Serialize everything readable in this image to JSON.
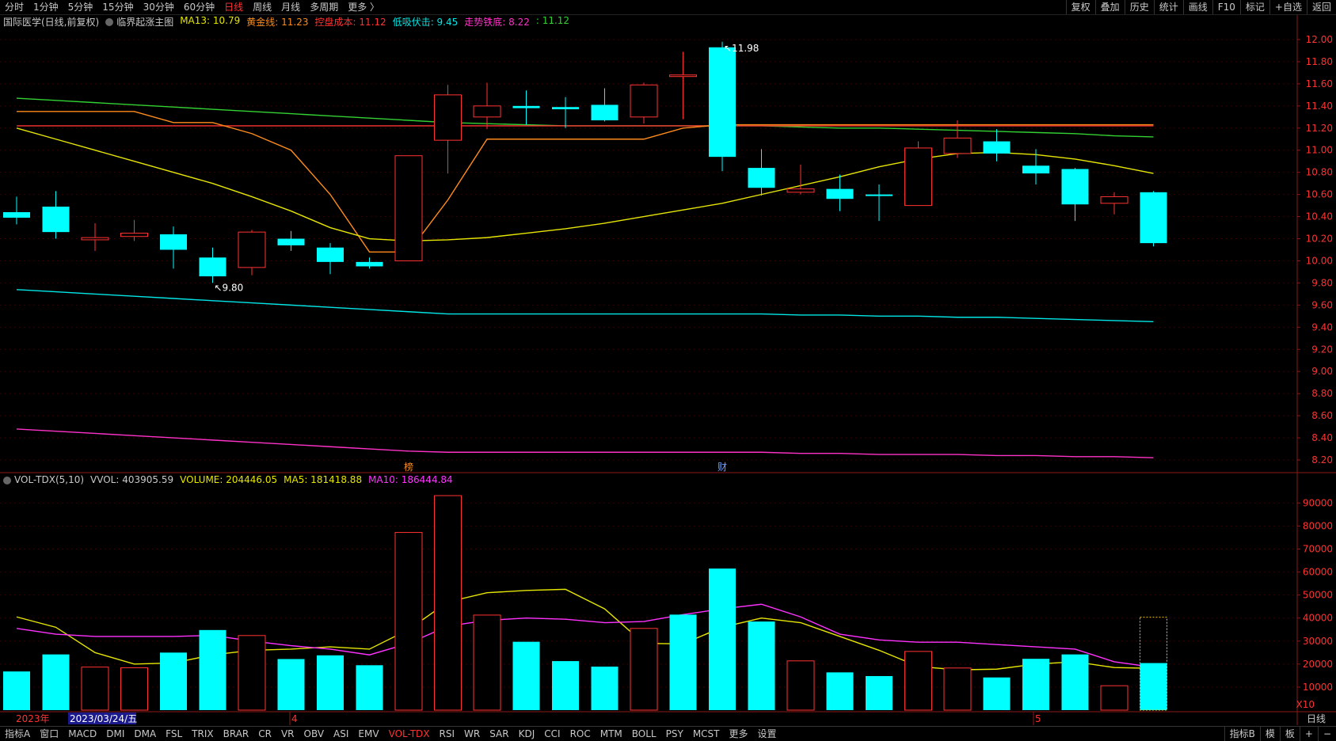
{
  "top_bar": {
    "tabs": [
      "分时",
      "1分钟",
      "5分钟",
      "15分钟",
      "30分钟",
      "60分钟",
      "日线",
      "周线",
      "月线",
      "多周期",
      "更多 〉"
    ],
    "active_tab": "日线",
    "right_tools": [
      "复权",
      "叠加",
      "历史",
      "统计",
      "画线",
      "F10",
      "标记",
      "+自选",
      "返回"
    ]
  },
  "main_legend": {
    "stock": "国际医学(日线,前复权)",
    "indicator": "临界起涨主图",
    "items": [
      {
        "label": "MA13: 10.79",
        "color": "#e6e600"
      },
      {
        "label": "黄金线: 11.23",
        "color": "#ff8c1a"
      },
      {
        "label": "控盘成本: 11.12",
        "color": "#ff3232"
      },
      {
        "label": "低吸伏击: 9.45",
        "color": "#00e6e6"
      },
      {
        "label": "走势铁底: 8.22",
        "color": "#ff32c8"
      },
      {
        "label": ": 11.12",
        "color": "#32d232"
      }
    ]
  },
  "vol_legend": {
    "indicator": "VOL-TDX(5,10)",
    "items": [
      {
        "label": "VVOL: 403905.59",
        "color": "#c8c8c8"
      },
      {
        "label": "VOLUME: 204446.05",
        "color": "#e6e600"
      },
      {
        "label": "MA5: 181418.88",
        "color": "#e6e600"
      },
      {
        "label": "MA10: 186444.84",
        "color": "#ff32ff"
      }
    ]
  },
  "price_axis": [
    "12.00",
    "11.80",
    "11.60",
    "11.40",
    "11.20",
    "11.00",
    "10.80",
    "10.60",
    "10.40",
    "10.20",
    "10.00",
    "9.80",
    "9.60",
    "9.40",
    "9.20",
    "9.00",
    "8.80",
    "8.60",
    "8.40",
    "8.20"
  ],
  "vol_axis": [
    "90000",
    "80000",
    "70000",
    "60000",
    "50000",
    "40000",
    "30000",
    "20000",
    "10000"
  ],
  "vol_axis_unit": "X10",
  "timeline": {
    "year": "2023年",
    "cursor_date": "2023/03/24/五",
    "month_4": "4",
    "month_5": "5",
    "period": "日线"
  },
  "annotations": {
    "high": "11.98",
    "low": "9.80",
    "mark_bang": "榜",
    "mark_cai": "财"
  },
  "bottom_tabs": [
    "指标A",
    "窗口",
    "MACD",
    "DMI",
    "DMA",
    "FSL",
    "TRIX",
    "BRAR",
    "CR",
    "VR",
    "OBV",
    "ASI",
    "EMV",
    "VOL-TDX",
    "RSI",
    "WR",
    "SAR",
    "KDJ",
    "CCI",
    "ROC",
    "MTM",
    "BOLL",
    "PSY",
    "MCST",
    "更多",
    "设置"
  ],
  "bottom_active": "VOL-TDX",
  "bottom_right": [
    "指标B",
    "模",
    "板",
    "+",
    "−"
  ],
  "chart_data": {
    "type": "candlestick",
    "up_color": "#ff3232",
    "down_color": "#00ffff",
    "candles": [
      {
        "o": 10.44,
        "h": 10.58,
        "l": 10.33,
        "c": 10.39
      },
      {
        "o": 10.49,
        "h": 10.63,
        "l": 10.2,
        "c": 10.26
      },
      {
        "o": 10.19,
        "h": 10.34,
        "l": 10.09,
        "c": 10.21
      },
      {
        "o": 10.22,
        "h": 10.37,
        "l": 10.18,
        "c": 10.25
      },
      {
        "o": 10.24,
        "h": 10.31,
        "l": 9.93,
        "c": 10.1
      },
      {
        "o": 10.03,
        "h": 10.12,
        "l": 9.8,
        "c": 9.86
      },
      {
        "o": 9.94,
        "h": 10.28,
        "l": 9.87,
        "c": 10.26
      },
      {
        "o": 10.2,
        "h": 10.27,
        "l": 10.09,
        "c": 10.14
      },
      {
        "o": 10.12,
        "h": 10.16,
        "l": 9.88,
        "c": 9.99
      },
      {
        "o": 9.99,
        "h": 10.03,
        "l": 9.93,
        "c": 9.95
      },
      {
        "o": 10.0,
        "h": 10.95,
        "l": 10.0,
        "c": 10.95
      },
      {
        "o": 11.09,
        "h": 11.59,
        "l": 10.79,
        "c": 11.5
      },
      {
        "o": 11.3,
        "h": 11.61,
        "l": 11.19,
        "c": 11.4
      },
      {
        "o": 11.4,
        "h": 11.54,
        "l": 11.23,
        "c": 11.38
      },
      {
        "o": 11.39,
        "h": 11.48,
        "l": 11.2,
        "c": 11.37
      },
      {
        "o": 11.41,
        "h": 11.56,
        "l": 11.26,
        "c": 11.27
      },
      {
        "o": 11.3,
        "h": 11.61,
        "l": 11.24,
        "c": 11.59
      },
      {
        "o": 11.68,
        "h": 11.89,
        "l": 11.28,
        "c": 11.68
      },
      {
        "o": 11.93,
        "h": 11.98,
        "l": 10.81,
        "c": 10.94
      },
      {
        "o": 10.84,
        "h": 11.01,
        "l": 10.59,
        "c": 10.66
      },
      {
        "o": 10.62,
        "h": 10.87,
        "l": 10.6,
        "c": 10.65
      },
      {
        "o": 10.65,
        "h": 10.78,
        "l": 10.45,
        "c": 10.56
      },
      {
        "o": 10.6,
        "h": 10.69,
        "l": 10.36,
        "c": 10.59
      },
      {
        "o": 10.5,
        "h": 11.08,
        "l": 10.5,
        "c": 11.02
      },
      {
        "o": 10.97,
        "h": 11.27,
        "l": 10.93,
        "c": 11.11
      },
      {
        "o": 11.08,
        "h": 11.19,
        "l": 10.9,
        "c": 10.97
      },
      {
        "o": 10.86,
        "h": 11.01,
        "l": 10.69,
        "c": 10.79
      },
      {
        "o": 10.83,
        "h": 10.84,
        "l": 10.36,
        "c": 10.51
      },
      {
        "o": 10.52,
        "h": 10.62,
        "l": 10.42,
        "c": 10.58
      },
      {
        "o": 10.62,
        "h": 10.63,
        "l": 10.13,
        "c": 10.16
      }
    ],
    "ma13": [
      11.2,
      11.1,
      11.0,
      10.9,
      10.8,
      10.7,
      10.58,
      10.45,
      10.3,
      10.2,
      10.18,
      10.19,
      10.21,
      10.25,
      10.29,
      10.34,
      10.4,
      10.46,
      10.52,
      10.6,
      10.68,
      10.76,
      10.85,
      10.92,
      10.97,
      10.98,
      10.96,
      10.92,
      10.86,
      10.79
    ],
    "golden_line": [
      11.35,
      11.35,
      11.35,
      11.35,
      11.25,
      11.25,
      11.15,
      11.0,
      10.6,
      10.08,
      10.08,
      10.55,
      11.1,
      11.1,
      11.1,
      11.1,
      11.1,
      11.2,
      11.23,
      11.23,
      11.23,
      11.23,
      11.23,
      11.23,
      11.23,
      11.23,
      11.23,
      11.23,
      11.23,
      11.23
    ],
    "cost_line": [
      11.22,
      11.22,
      11.22,
      11.22,
      11.22,
      11.22,
      11.22,
      11.22,
      11.22,
      11.22,
      11.22,
      11.22,
      11.22,
      11.22,
      11.22,
      11.22,
      11.22,
      11.22,
      11.22,
      11.22,
      11.22,
      11.22,
      11.22,
      11.22,
      11.22,
      11.22,
      11.22,
      11.22,
      11.22,
      11.22
    ],
    "green_line": [
      11.47,
      11.45,
      11.43,
      11.41,
      11.39,
      11.37,
      11.35,
      11.33,
      11.31,
      11.29,
      11.27,
      11.25,
      11.24,
      11.23,
      11.22,
      11.22,
      11.22,
      11.22,
      11.22,
      11.22,
      11.21,
      11.2,
      11.2,
      11.19,
      11.18,
      11.17,
      11.16,
      11.15,
      11.13,
      11.12
    ],
    "ambush_line": [
      9.74,
      9.72,
      9.7,
      9.68,
      9.66,
      9.64,
      9.62,
      9.6,
      9.58,
      9.56,
      9.54,
      9.52,
      9.52,
      9.52,
      9.52,
      9.52,
      9.52,
      9.52,
      9.52,
      9.52,
      9.51,
      9.51,
      9.5,
      9.5,
      9.49,
      9.49,
      9.48,
      9.47,
      9.46,
      9.45
    ],
    "bottom_line": [
      8.48,
      8.46,
      8.44,
      8.42,
      8.4,
      8.38,
      8.36,
      8.34,
      8.32,
      8.3,
      8.28,
      8.27,
      8.27,
      8.27,
      8.27,
      8.27,
      8.27,
      8.27,
      8.27,
      8.27,
      8.26,
      8.26,
      8.25,
      8.25,
      8.25,
      8.24,
      8.24,
      8.23,
      8.23,
      8.22
    ],
    "volume": [
      {
        "v": 16800,
        "up": false
      },
      {
        "v": 24200,
        "up": false
      },
      {
        "v": 18700,
        "up": true
      },
      {
        "v": 18400,
        "up": true
      },
      {
        "v": 25000,
        "up": false
      },
      {
        "v": 34800,
        "up": false
      },
      {
        "v": 32400,
        "up": true
      },
      {
        "v": 22200,
        "up": false
      },
      {
        "v": 23800,
        "up": false
      },
      {
        "v": 19500,
        "up": false
      },
      {
        "v": 77200,
        "up": true
      },
      {
        "v": 93200,
        "up": true
      },
      {
        "v": 41300,
        "up": true
      },
      {
        "v": 29700,
        "up": false
      },
      {
        "v": 21300,
        "up": false
      },
      {
        "v": 18900,
        "up": false
      },
      {
        "v": 35500,
        "up": true
      },
      {
        "v": 41500,
        "up": false
      },
      {
        "v": 61500,
        "up": false
      },
      {
        "v": 38500,
        "up": false
      },
      {
        "v": 21400,
        "up": true
      },
      {
        "v": 16400,
        "up": false
      },
      {
        "v": 14800,
        "up": false
      },
      {
        "v": 25500,
        "up": true
      },
      {
        "v": 18300,
        "up": true
      },
      {
        "v": 14200,
        "up": false
      },
      {
        "v": 22300,
        "up": false
      },
      {
        "v": 24200,
        "up": false
      },
      {
        "v": 10600,
        "up": true
      },
      {
        "v": 20444,
        "up": false
      }
    ],
    "vvol_current": 40390,
    "vol_ma5": [
      40500,
      36000,
      25000,
      20000,
      20500,
      24000,
      26000,
      26500,
      27500,
      26500,
      35000,
      47000,
      51000,
      52000,
      52500,
      44000,
      29000,
      28800,
      36000,
      40000,
      38000,
      32000,
      26000,
      19000,
      17500,
      17800,
      20000,
      21000,
      18500,
      18142
    ],
    "vol_ma10": [
      35500,
      33000,
      32000,
      32000,
      32000,
      32500,
      30000,
      28000,
      26500,
      24000,
      29000,
      36500,
      39000,
      40000,
      39500,
      38000,
      38500,
      41500,
      44000,
      46000,
      40500,
      33000,
      30500,
      29500,
      29500,
      28500,
      27500,
      26500,
      21000,
      18644
    ],
    "price_range": [
      8.1,
      12.1
    ],
    "vol_range": [
      0,
      97000
    ]
  }
}
